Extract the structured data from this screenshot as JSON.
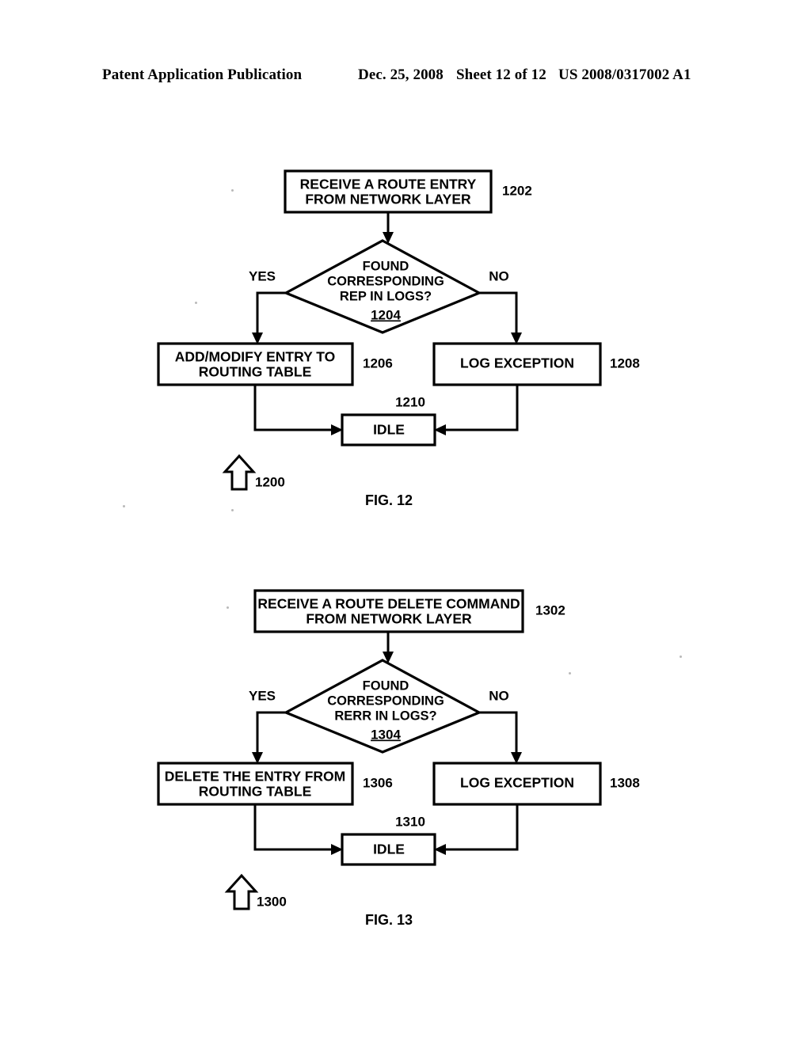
{
  "header": {
    "publication": "Patent Application Publication",
    "date": "Dec. 25, 2008",
    "sheet": "Sheet 12 of 12",
    "patent_number": "US 2008/0317002 A1"
  },
  "figures": [
    {
      "caption": "FIG. 12",
      "diagram_ref": "1200",
      "start": {
        "ref": "1202",
        "line1": "RECEIVE A ROUTE ENTRY",
        "line2": "FROM NETWORK LAYER"
      },
      "decision": {
        "ref": "1204",
        "line1": "FOUND",
        "line2": "CORRESPONDING",
        "line3": "REP IN LOGS?",
        "yes_label": "YES",
        "no_label": "NO"
      },
      "yes_branch": {
        "ref": "1206",
        "line1": "ADD/MODIFY ENTRY TO",
        "line2": "ROUTING TABLE"
      },
      "no_branch": {
        "ref": "1208",
        "line1": "LOG EXCEPTION",
        "line2": ""
      },
      "end": {
        "ref": "1210",
        "line1": "IDLE"
      }
    },
    {
      "caption": "FIG. 13",
      "diagram_ref": "1300",
      "start": {
        "ref": "1302",
        "line1": "RECEIVE A ROUTE DELETE COMMAND",
        "line2": "FROM NETWORK LAYER"
      },
      "decision": {
        "ref": "1304",
        "line1": "FOUND",
        "line2": "CORRESPONDING",
        "line3": "RERR IN LOGS?",
        "yes_label": "YES",
        "no_label": "NO"
      },
      "yes_branch": {
        "ref": "1306",
        "line1": "DELETE THE ENTRY FROM",
        "line2": "ROUTING TABLE"
      },
      "no_branch": {
        "ref": "1308",
        "line1": "LOG EXCEPTION",
        "line2": ""
      },
      "end": {
        "ref": "1310",
        "line1": "IDLE"
      }
    }
  ],
  "colors": {
    "ink": "#000000",
    "paper": "#ffffff"
  }
}
